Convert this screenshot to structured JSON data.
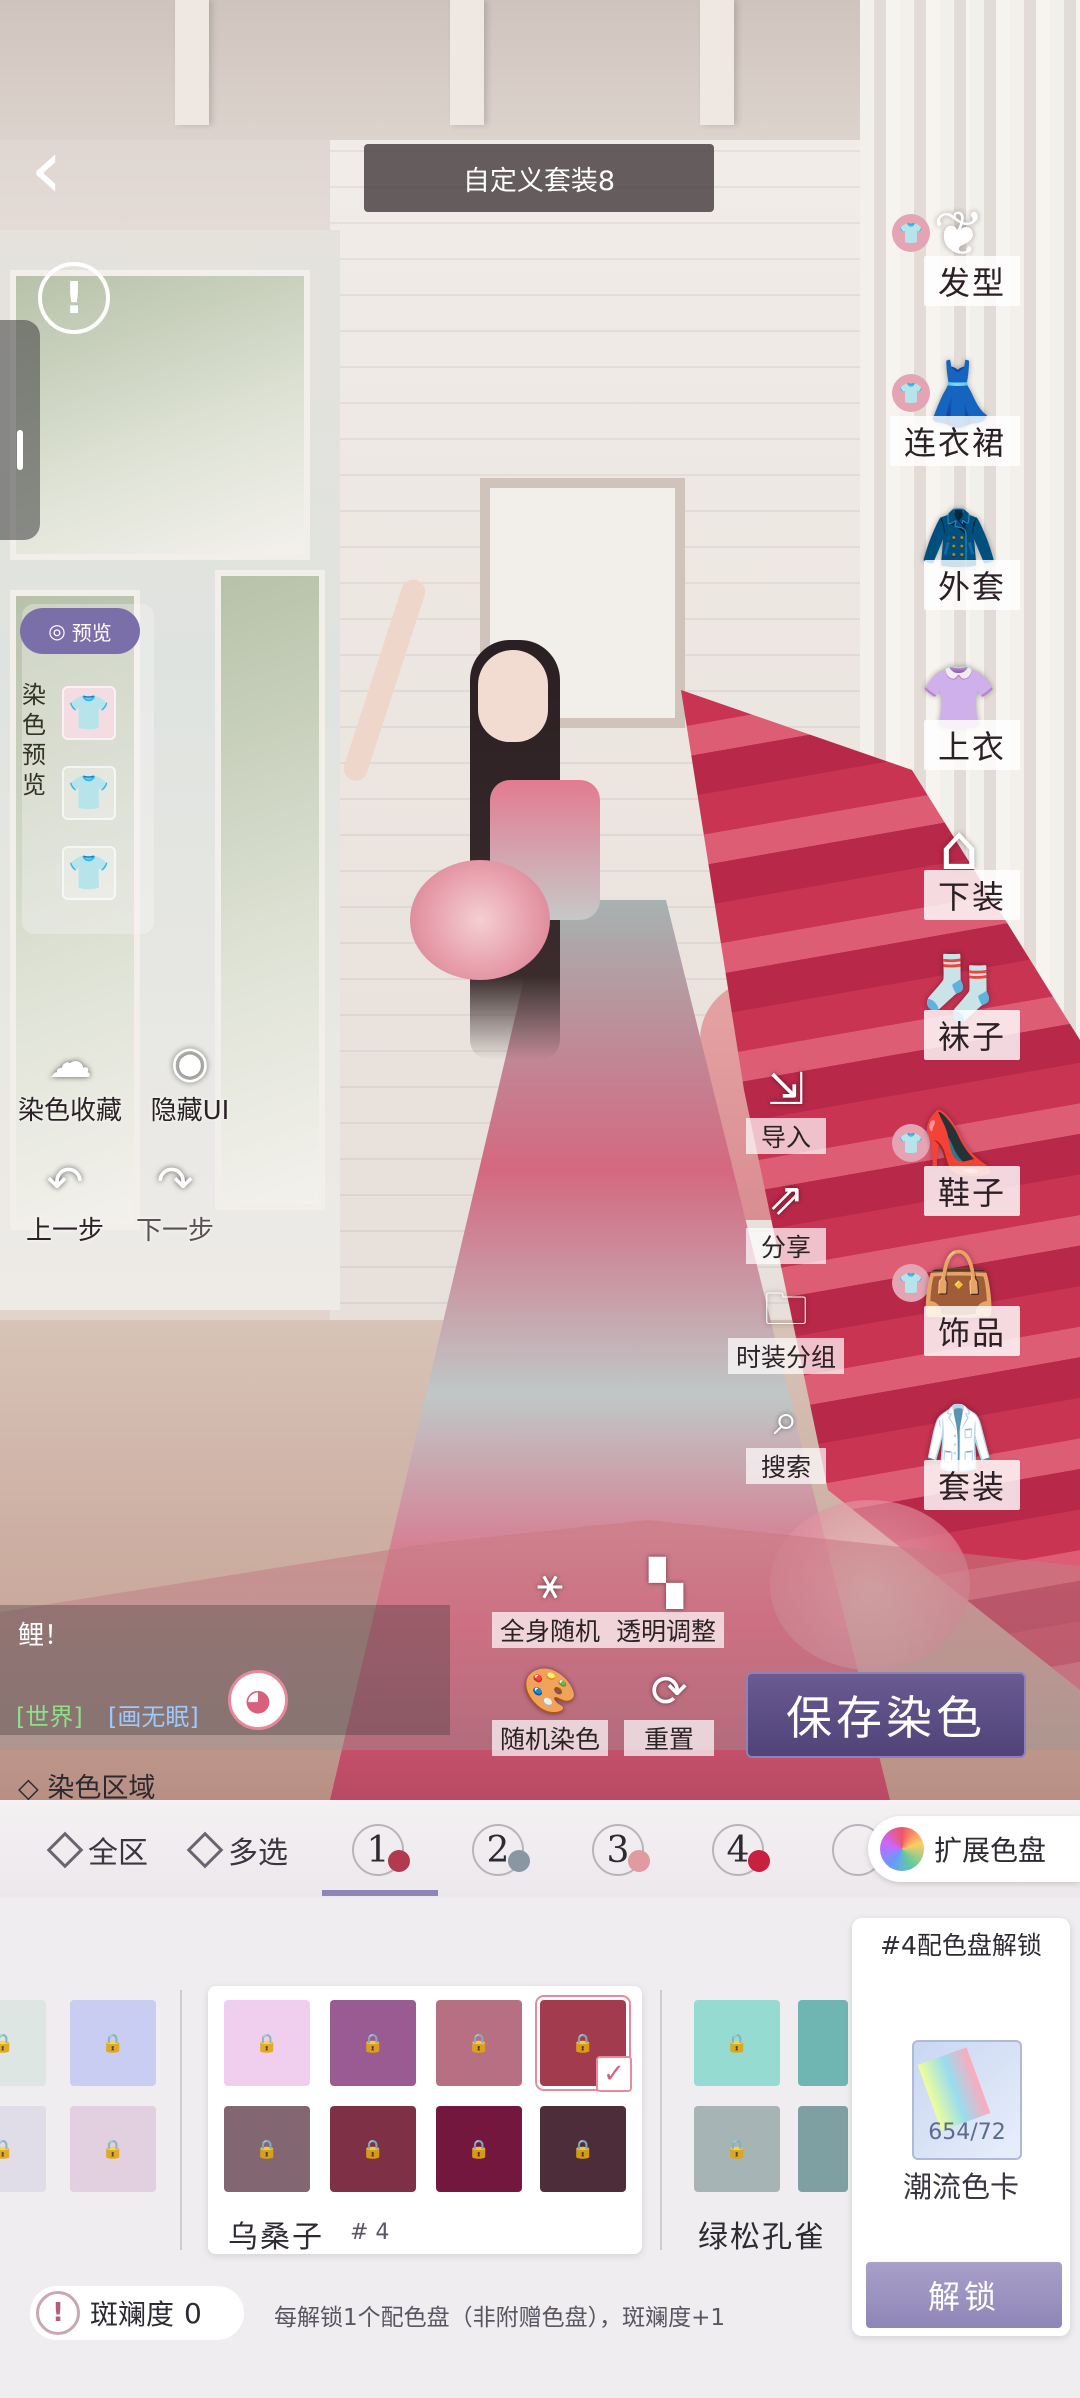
{
  "header": {
    "title": "自定义套装8"
  },
  "left_panel": {
    "preview_pill": "预览",
    "dye_preview_label": "染色预览",
    "tools": [
      {
        "label": "染色收藏",
        "icon": "favorite-cloud-icon"
      },
      {
        "label": "隐藏UI",
        "icon": "eye-hide-icon"
      },
      {
        "label": "上一步",
        "icon": "undo-arrow-icon"
      },
      {
        "label": "下一步",
        "icon": "redo-arrow-icon"
      }
    ]
  },
  "right_categories": [
    {
      "label": "发型",
      "icon": "hair-icon",
      "badge": true
    },
    {
      "label": "连衣裙",
      "icon": "dress-icon",
      "badge": true
    },
    {
      "label": "外套",
      "icon": "coat-icon",
      "badge": false
    },
    {
      "label": "上衣",
      "icon": "top-icon",
      "badge": false
    },
    {
      "label": "下装",
      "icon": "skirt-icon",
      "badge": false
    },
    {
      "label": "袜子",
      "icon": "socks-icon",
      "badge": false
    },
    {
      "label": "鞋子",
      "icon": "shoe-icon",
      "badge": true
    },
    {
      "label": "饰品",
      "icon": "accessory-icon",
      "badge": true
    },
    {
      "label": "套装",
      "icon": "suit-icon",
      "badge": false
    }
  ],
  "mid_tools": [
    {
      "label": "导入",
      "icon": "import-icon"
    },
    {
      "label": "分享",
      "icon": "share-icon"
    },
    {
      "label": "时装分组",
      "icon": "folder-icon"
    },
    {
      "label": "搜索",
      "icon": "search-icon"
    }
  ],
  "bottom_tools": [
    {
      "label": "全身随机",
      "icon": "random-body-icon"
    },
    {
      "label": "透明调整",
      "icon": "transparency-icon"
    },
    {
      "label": "随机染色",
      "icon": "palette-random-icon"
    },
    {
      "label": "重置",
      "icon": "reset-icon"
    }
  ],
  "save_button": "保存染色",
  "chat": {
    "message": "鲤！",
    "channel_world": "[世界]",
    "channel_user": "[画无眠]"
  },
  "dye_zone_label": "染色区域",
  "selector": {
    "all_zone": "全区",
    "multi_select": "多选",
    "slots": [
      {
        "num": "1",
        "color": "#b23a4e"
      },
      {
        "num": "2",
        "color": "#8a97a3"
      },
      {
        "num": "3",
        "color": "#e09aa2"
      },
      {
        "num": "4",
        "color": "#c8203f"
      },
      {
        "num": "",
        "color": "#ffffff"
      }
    ],
    "expand_label": "扩展色盘"
  },
  "palette": {
    "left_group_colors": [
      "#dde6e3",
      "#c9cdf2",
      "#e1dde8",
      "#e2cfdf"
    ],
    "group": {
      "name": "乌桑子",
      "code": "# 4",
      "colors": [
        "#f0cfee",
        "#9a5a92",
        "#b76f84",
        "#a33b4e",
        "#826672",
        "#7d3046",
        "#73173f",
        "#4e2d3a"
      ],
      "selected_index": 3
    },
    "next_group": {
      "name": "绿松孔雀",
      "colors": [
        "#96dbd2",
        "#6fb6b3",
        "#a6b4b5",
        "#7fa0a2"
      ]
    }
  },
  "unlock_card": {
    "title": "#4配色盘解锁",
    "count": "654/72",
    "item_name": "潮流色卡",
    "button": "解锁"
  },
  "footer": {
    "rarity_label": "斑斓度",
    "rarity_value": "0",
    "hint": "每解锁1个配色盘（非附赠色盘），斑斓度+1"
  }
}
